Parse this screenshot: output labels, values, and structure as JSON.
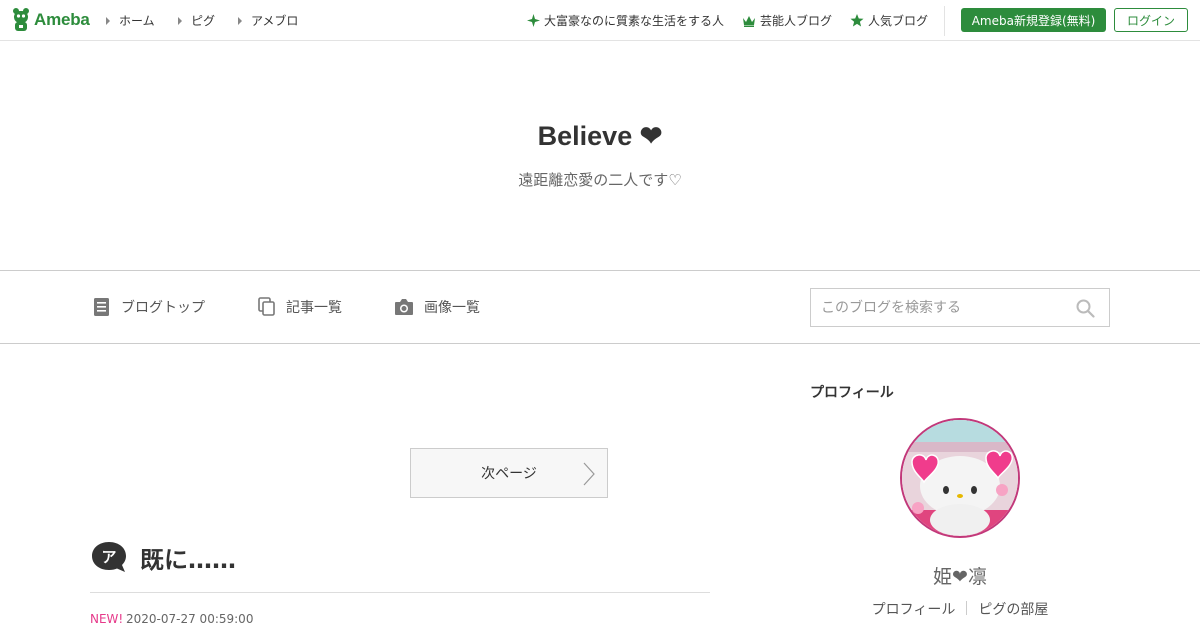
{
  "header": {
    "logo_text": "Ameba",
    "nav": [
      {
        "label": "ホーム"
      },
      {
        "label": "ピグ"
      },
      {
        "label": "アメブロ"
      }
    ],
    "promos": [
      {
        "label": "大富豪なのに質素な生活をする人",
        "icon": "sparkle-icon"
      },
      {
        "label": "芸能人ブログ",
        "icon": "crown-icon"
      },
      {
        "label": "人気ブログ",
        "icon": "star-icon"
      }
    ],
    "register_label": "Ameba新規登録(無料)",
    "login_label": "ログイン",
    "accent_color": "#2d8c3c"
  },
  "blog": {
    "title": "Believe ❤",
    "subtitle": "遠距離恋愛の二人です♡"
  },
  "subnav": {
    "items": [
      {
        "label": "ブログトップ",
        "icon": "document-icon"
      },
      {
        "label": "記事一覧",
        "icon": "copy-icon"
      },
      {
        "label": "画像一覧",
        "icon": "camera-icon"
      }
    ],
    "search_placeholder": "このブログを検索する"
  },
  "main": {
    "next_page_label": "次ページ",
    "entry": {
      "title": "既に……",
      "new_label": "NEW!",
      "date": "2020-07-27 00:59:00"
    }
  },
  "sidebar": {
    "heading": "プロフィール",
    "profile_name": "姫❤凛",
    "links": [
      {
        "label": "プロフィール"
      },
      {
        "label": "ピグの部屋"
      }
    ]
  }
}
